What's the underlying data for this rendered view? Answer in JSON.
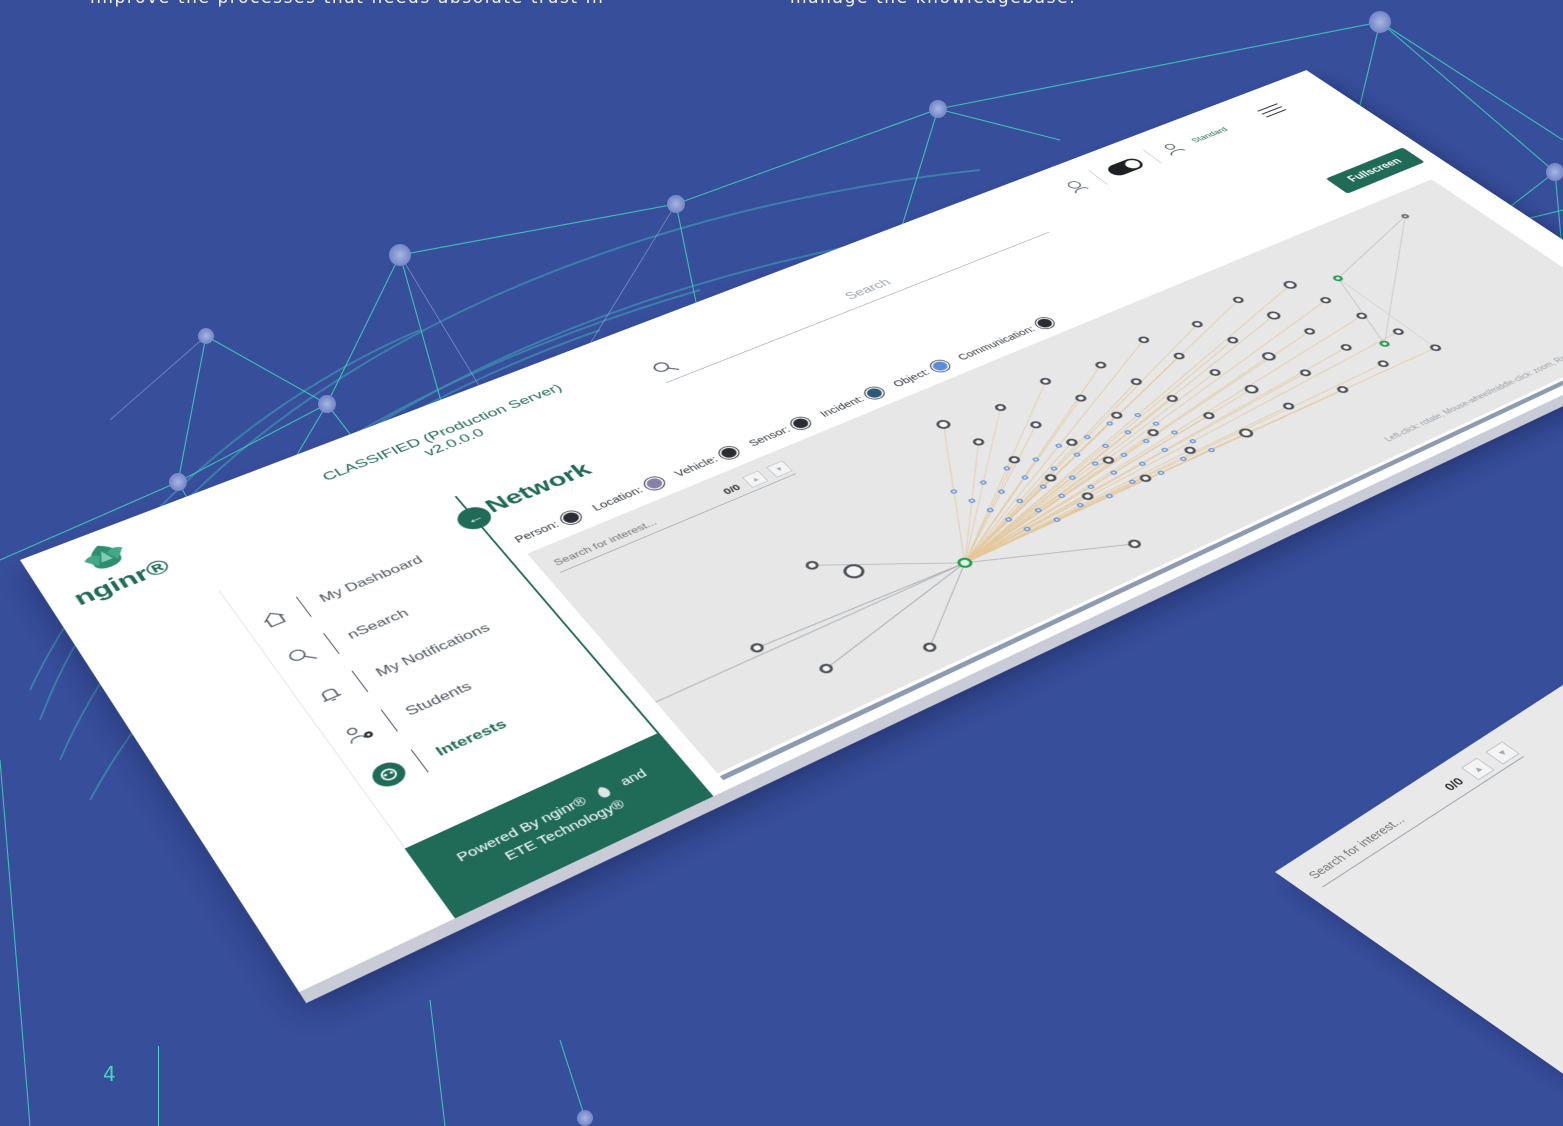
{
  "intro": {
    "left_text": "improve the processes that needs absolute trust in",
    "right_text": "manage the knowledgebase."
  },
  "page_number": "4",
  "app": {
    "logo_text": "nginr®",
    "server_name": "CLASSIFIED (Production Server)",
    "version": "v2.0.0.0",
    "search_placeholder": "Search",
    "user": {
      "name": "",
      "role": "Standard"
    },
    "fullscreen_label": "Fullscreen",
    "nav": [
      {
        "label": "My Dashboard",
        "icon": "home-icon"
      },
      {
        "label": "nSearch",
        "icon": "search-icon"
      },
      {
        "label": "My Notifications",
        "icon": "bell-icon"
      },
      {
        "label": "Students",
        "icon": "users-settings-icon"
      },
      {
        "label": "Interests",
        "icon": "interests-icon",
        "active": true
      }
    ],
    "collapse_icon": "arrow-left-icon",
    "powered": {
      "line1": "Powered By nginr®",
      "and": "and",
      "line2": "ETE Technology®"
    },
    "page": {
      "title": "Network",
      "subtitle": ""
    },
    "legend": [
      {
        "label": "Person:",
        "color": "#2a2d33"
      },
      {
        "label": "Location:",
        "color": "#8a7fa8"
      },
      {
        "label": "Vehicle:",
        "color": "#2a2d33"
      },
      {
        "label": "Sensor:",
        "color": "#2a2d33"
      },
      {
        "label": "Incident:",
        "color": "#2a5a78"
      },
      {
        "label": "Object:",
        "color": "#5a8fd8"
      },
      {
        "label": "Communication:",
        "color": "#2a2d33"
      }
    ],
    "graph_search": {
      "placeholder": "Search for interest...",
      "count": "0/0",
      "up_icon": "caret-up-icon",
      "down_icon": "caret-down-icon"
    },
    "graph_hint": "Left-click: rotate, Mouse-wheel/middle-click: zoom, Right-click: pan"
  },
  "secondary_card": {
    "placeholder": "Search for interest...",
    "count": "0/0"
  },
  "colors": {
    "background": "#374e9b",
    "accent": "#1f6b57",
    "network_lines": "#4fd0c3",
    "graph_panel": "#e7e7e7"
  }
}
